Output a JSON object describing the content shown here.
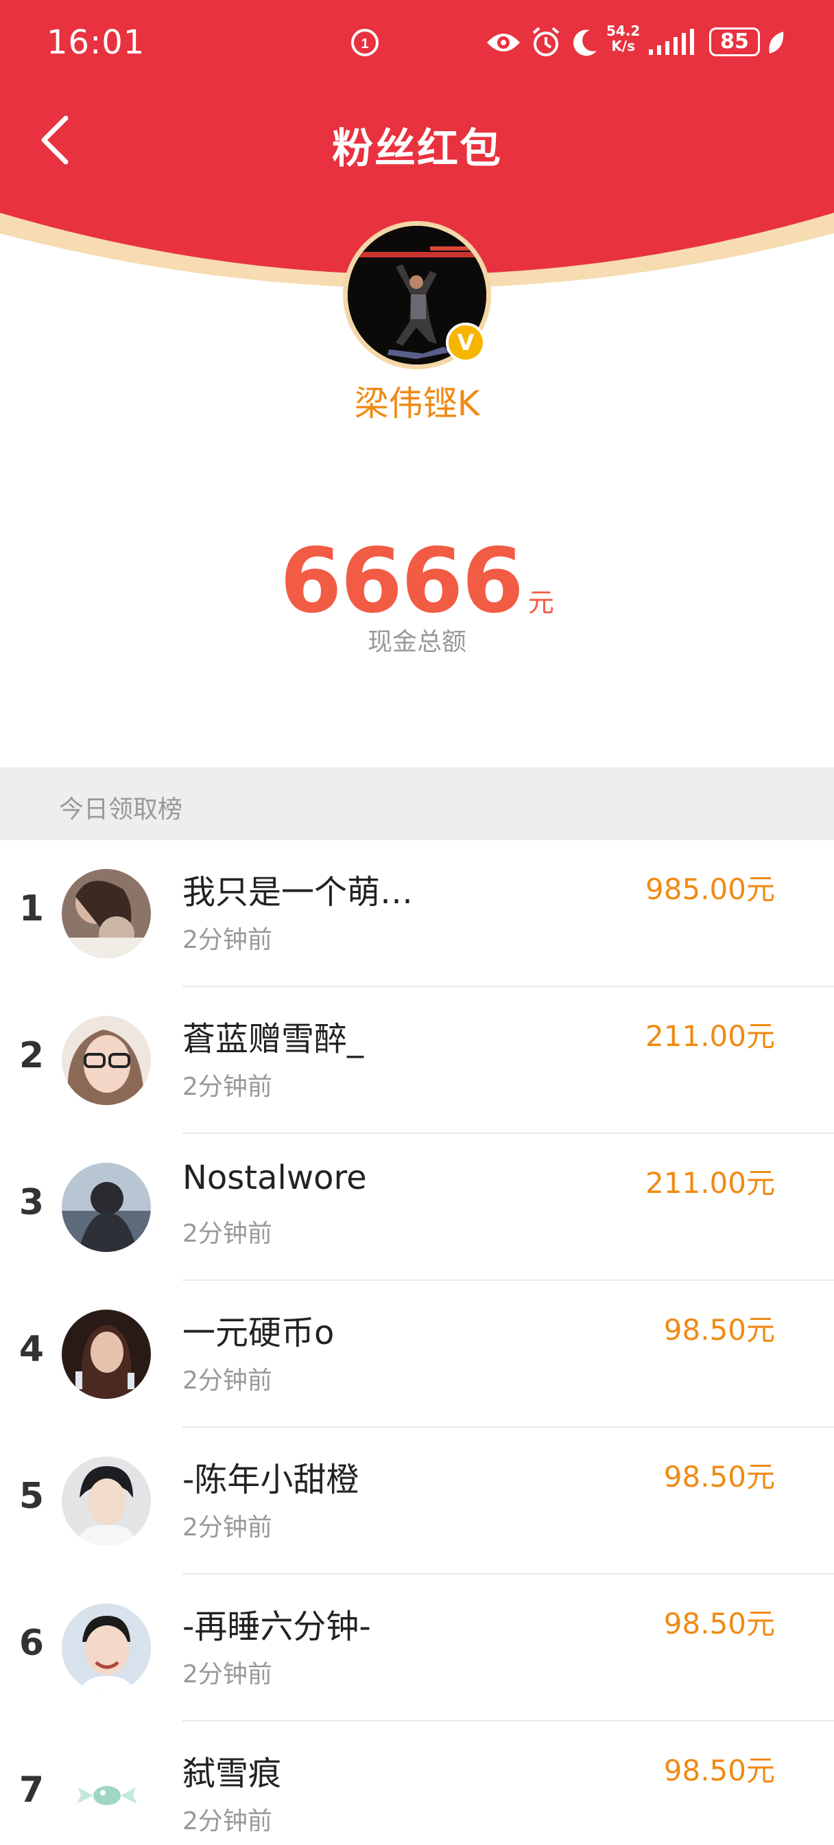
{
  "status_bar": {
    "time": "16:01",
    "network_speed_value": "54.2",
    "network_speed_unit": "K/s",
    "battery": "85",
    "icons": [
      "app-notification-icon",
      "eye-icon",
      "alarm-icon",
      "moon-icon",
      "signal-icon",
      "battery-icon",
      "leaf-icon"
    ]
  },
  "header": {
    "title": "粉丝红包",
    "back_icon": "chevron-left-icon"
  },
  "profile": {
    "name": "梁伟铿K",
    "verified_label": "V"
  },
  "summary": {
    "amount": "6666",
    "unit": "元",
    "label": "现金总额"
  },
  "leaderboard": {
    "title": "今日领取榜",
    "items": [
      {
        "rank": "1",
        "name": "我只是一个萌…",
        "time": "2分钟前",
        "amount": "985.00元"
      },
      {
        "rank": "2",
        "name": "蒼蓝赠雪醉_",
        "time": "2分钟前",
        "amount": "211.00元"
      },
      {
        "rank": "3",
        "name": "Nostalwore",
        "time": "2分钟前",
        "amount": "211.00元"
      },
      {
        "rank": "4",
        "name": "一元硬币o",
        "time": "2分钟前",
        "amount": "98.50元"
      },
      {
        "rank": "5",
        "name": "-陈年小甜橙",
        "time": "2分钟前",
        "amount": "98.50元"
      },
      {
        "rank": "6",
        "name": "-再睡六分钟-",
        "time": "2分钟前",
        "amount": "98.50元"
      },
      {
        "rank": "7",
        "name": "弑雪痕",
        "time": "2分钟前",
        "amount": "98.50元"
      }
    ]
  },
  "colors": {
    "header_red": "#e8323f",
    "gold_edge": "#f6dcb0",
    "accent_orange": "#f08a14",
    "amount_red": "#f25c44"
  }
}
